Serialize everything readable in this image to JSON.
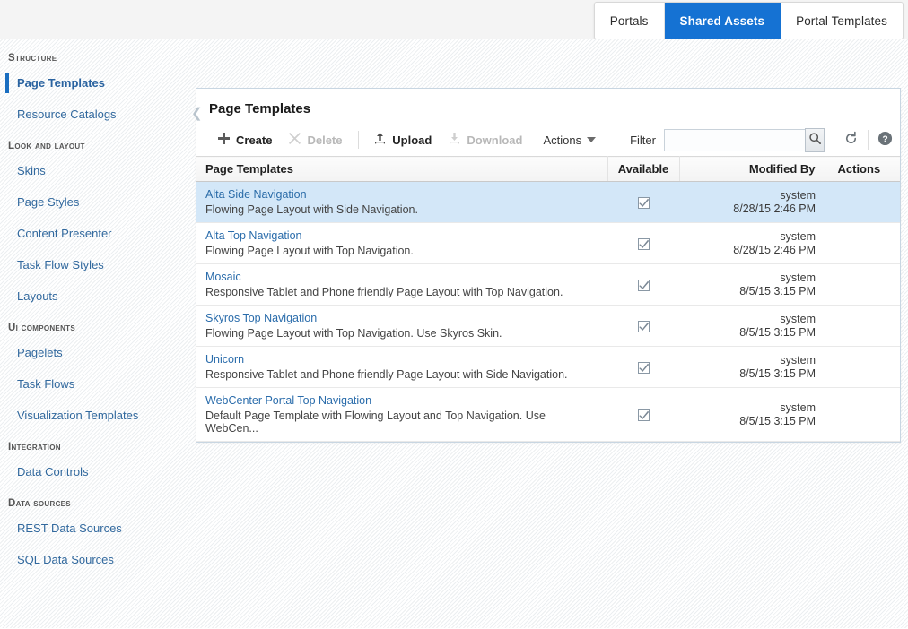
{
  "header": {
    "tabs": [
      {
        "label": "Portals",
        "active": false
      },
      {
        "label": "Shared Assets",
        "active": true
      },
      {
        "label": "Portal Templates",
        "active": false
      }
    ],
    "active_tab_color": "#1572d3"
  },
  "sidebar": {
    "groups": [
      {
        "title": "Structure",
        "items": [
          {
            "label": "Page Templates",
            "active": true
          },
          {
            "label": "Resource Catalogs",
            "active": false
          }
        ]
      },
      {
        "title": "Look and Layout",
        "items": [
          {
            "label": "Skins",
            "active": false
          },
          {
            "label": "Page Styles",
            "active": false
          },
          {
            "label": "Content Presenter",
            "active": false
          },
          {
            "label": "Task Flow Styles",
            "active": false
          },
          {
            "label": "Layouts",
            "active": false
          }
        ]
      },
      {
        "title": "UI Components",
        "items": [
          {
            "label": "Pagelets",
            "active": false
          },
          {
            "label": "Task Flows",
            "active": false
          },
          {
            "label": "Visualization Templates",
            "active": false
          }
        ]
      },
      {
        "title": "Integration",
        "items": [
          {
            "label": "Data Controls",
            "active": false
          }
        ]
      },
      {
        "title": "Data Sources",
        "items": [
          {
            "label": "REST Data Sources",
            "active": false
          },
          {
            "label": "SQL Data Sources",
            "active": false
          }
        ]
      }
    ]
  },
  "panel": {
    "title": "Page Templates",
    "collapse_icon": "chevron-left-icon"
  },
  "toolbar": {
    "create_label": "Create",
    "delete_label": "Delete",
    "upload_label": "Upload",
    "download_label": "Download",
    "actions_label": "Actions",
    "filter_label": "Filter",
    "filter_value": "",
    "filter_placeholder": "",
    "search_icon": "search-icon",
    "refresh_icon": "refresh-icon",
    "help_icon": "help-icon",
    "disabled_color": "#b8b8b8"
  },
  "table": {
    "columns": {
      "name": "Page Templates",
      "available": "Available",
      "modified_by": "Modified By",
      "actions": "Actions"
    },
    "rows": [
      {
        "name": "Alta Side Navigation",
        "description": "Flowing Page Layout with Side Navigation.",
        "available": true,
        "modified_by": "system",
        "modified_date": "8/28/15 2:46 PM",
        "selected": true
      },
      {
        "name": "Alta Top Navigation",
        "description": "Flowing Page Layout with Top Navigation.",
        "available": true,
        "modified_by": "system",
        "modified_date": "8/28/15 2:46 PM",
        "selected": false
      },
      {
        "name": "Mosaic",
        "description": "Responsive Tablet and Phone friendly Page Layout with Top Navigation.",
        "available": true,
        "modified_by": "system",
        "modified_date": "8/5/15 3:15 PM",
        "selected": false
      },
      {
        "name": "Skyros Top Navigation",
        "description": "Flowing Page Layout with Top Navigation. Use Skyros Skin.",
        "available": true,
        "modified_by": "system",
        "modified_date": "8/5/15 3:15 PM",
        "selected": false
      },
      {
        "name": "Unicorn",
        "description": "Responsive Tablet and Phone friendly Page Layout with Side Navigation.",
        "available": true,
        "modified_by": "system",
        "modified_date": "8/5/15 3:15 PM",
        "selected": false
      },
      {
        "name": "WebCenter Portal Top Navigation",
        "description": "Default Page Template with Flowing Layout and Top Navigation. Use WebCen...",
        "available": true,
        "modified_by": "system",
        "modified_date": "8/5/15 3:15 PM",
        "selected": false
      }
    ]
  }
}
